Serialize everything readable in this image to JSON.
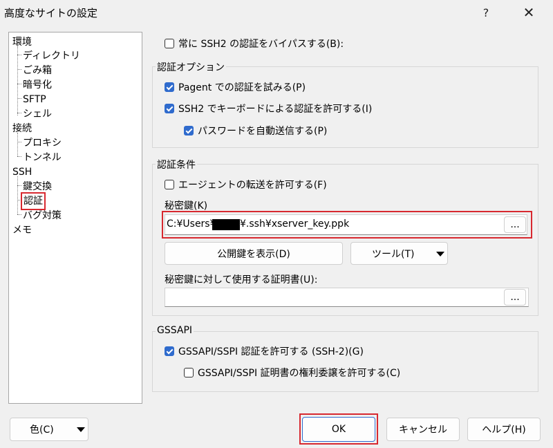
{
  "window": {
    "title": "高度なサイトの設定",
    "help": "?",
    "close": "✕"
  },
  "tree": {
    "items": [
      "環境",
      "ディレクトリ",
      "ごみ箱",
      "暗号化",
      "SFTP",
      "シェル",
      "接続",
      "プロキシ",
      "トンネル",
      "SSH",
      "鍵交換",
      "認証",
      "バグ対策",
      "メモ"
    ],
    "selected": "認証"
  },
  "bypass": {
    "label": "常に SSH2 の認証をバイパスする(B):",
    "checked": false
  },
  "auth_options": {
    "title": "認証オプション",
    "pagent": "Pagent での認証を試みる(P)",
    "keyboard": "SSH2 でキーボードによる認証を許可する(I)",
    "auto_password": "パスワードを自動送信する(P)"
  },
  "auth_conditions": {
    "title": "認証条件",
    "agent_forward": "エージェントの転送を許可する(F)",
    "private_key_label": "秘密鍵(K)",
    "private_key_prefix": "C:¥Users¥",
    "private_key_suffix": "¥.ssh¥xserver_key.ppk",
    "browse": "...",
    "show_public_key": "公開鍵を表示(D)",
    "tools": "ツール(T)",
    "cert_label": "秘密鍵に対して使用する証明書(U):",
    "cert_value": "",
    "browse2": "..."
  },
  "gssapi": {
    "title": "GSSAPI",
    "allow": "GSSAPI/SSPI 認証を許可する (SSH-2)(G)",
    "delegation": "GSSAPI/SSPI 証明書の権利委譲を許可する(C)"
  },
  "footer": {
    "color": "色(C)",
    "ok": "OK",
    "cancel": "キャンセル",
    "help": "ヘルプ(H)"
  },
  "colors": {
    "accent": "#2f6bcd",
    "highlight": "#d7282f"
  }
}
